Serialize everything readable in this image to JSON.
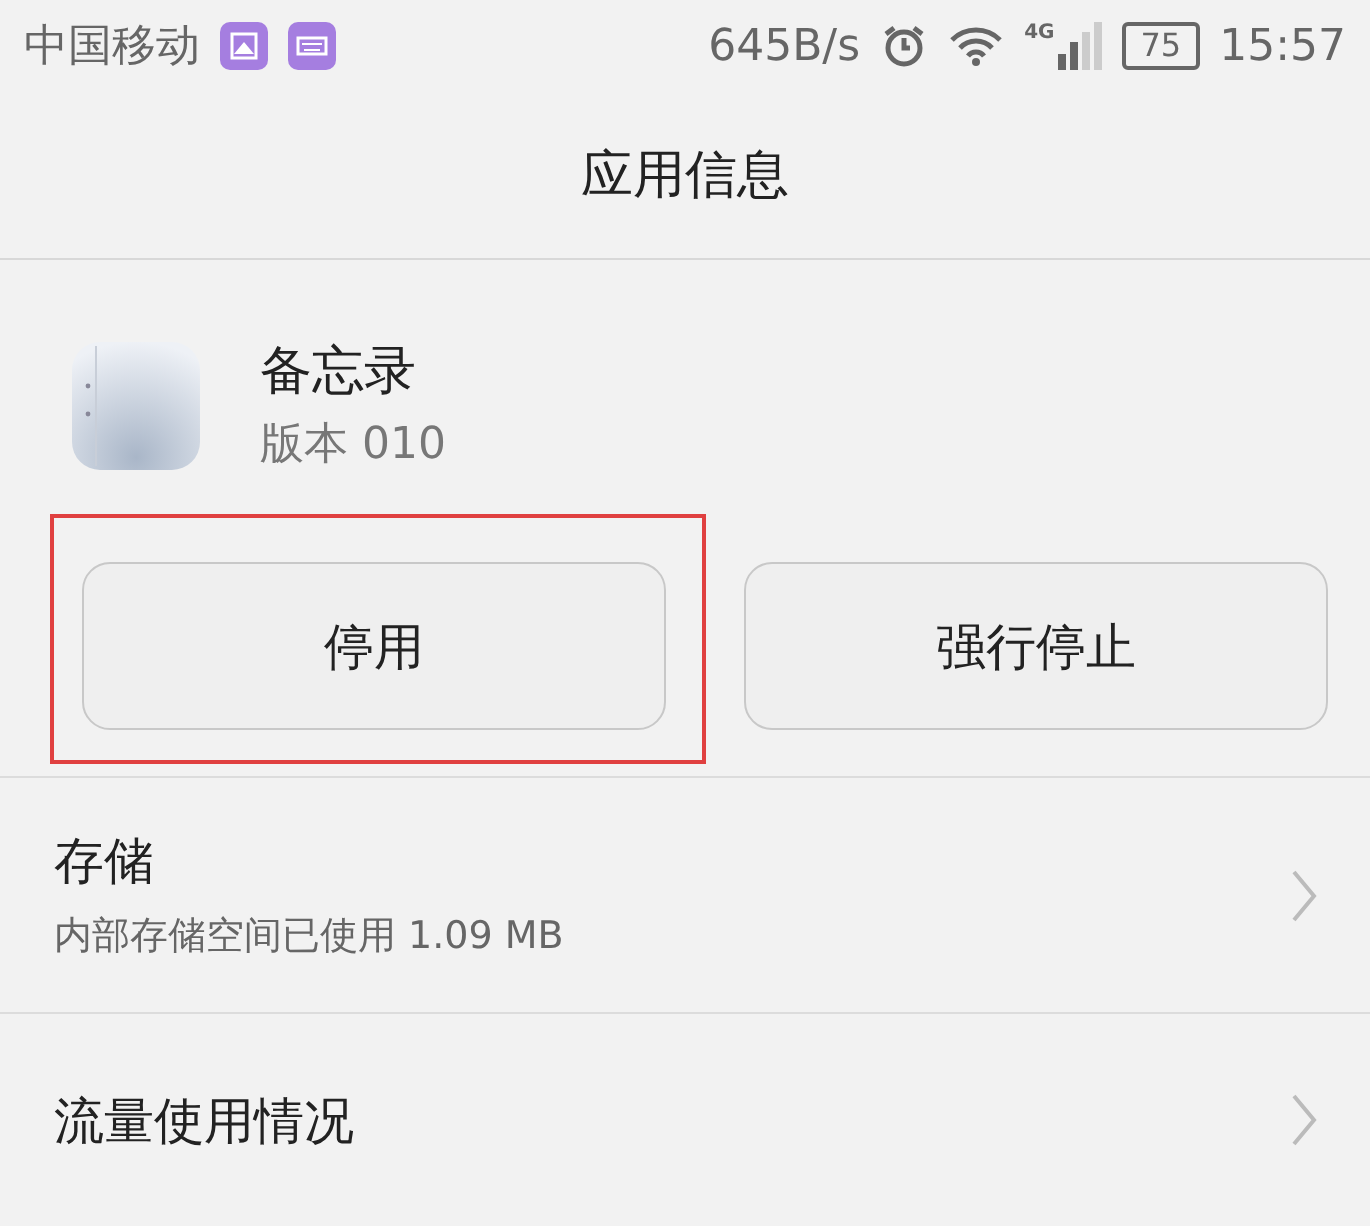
{
  "status_bar": {
    "carrier": "中国移动",
    "speed": "645B/s",
    "network": "4G",
    "battery": "75",
    "time": "15:57"
  },
  "header": {
    "title": "应用信息"
  },
  "app": {
    "name": "备忘录",
    "version": "版本 010"
  },
  "buttons": [
    {
      "label": "停用",
      "highlighted": true
    },
    {
      "label": "强行停止",
      "highlighted": false
    }
  ],
  "rows": [
    {
      "title": "存储",
      "subtitle": "内部存储空间已使用 1.09 MB"
    },
    {
      "title": "流量使用情况"
    }
  ]
}
